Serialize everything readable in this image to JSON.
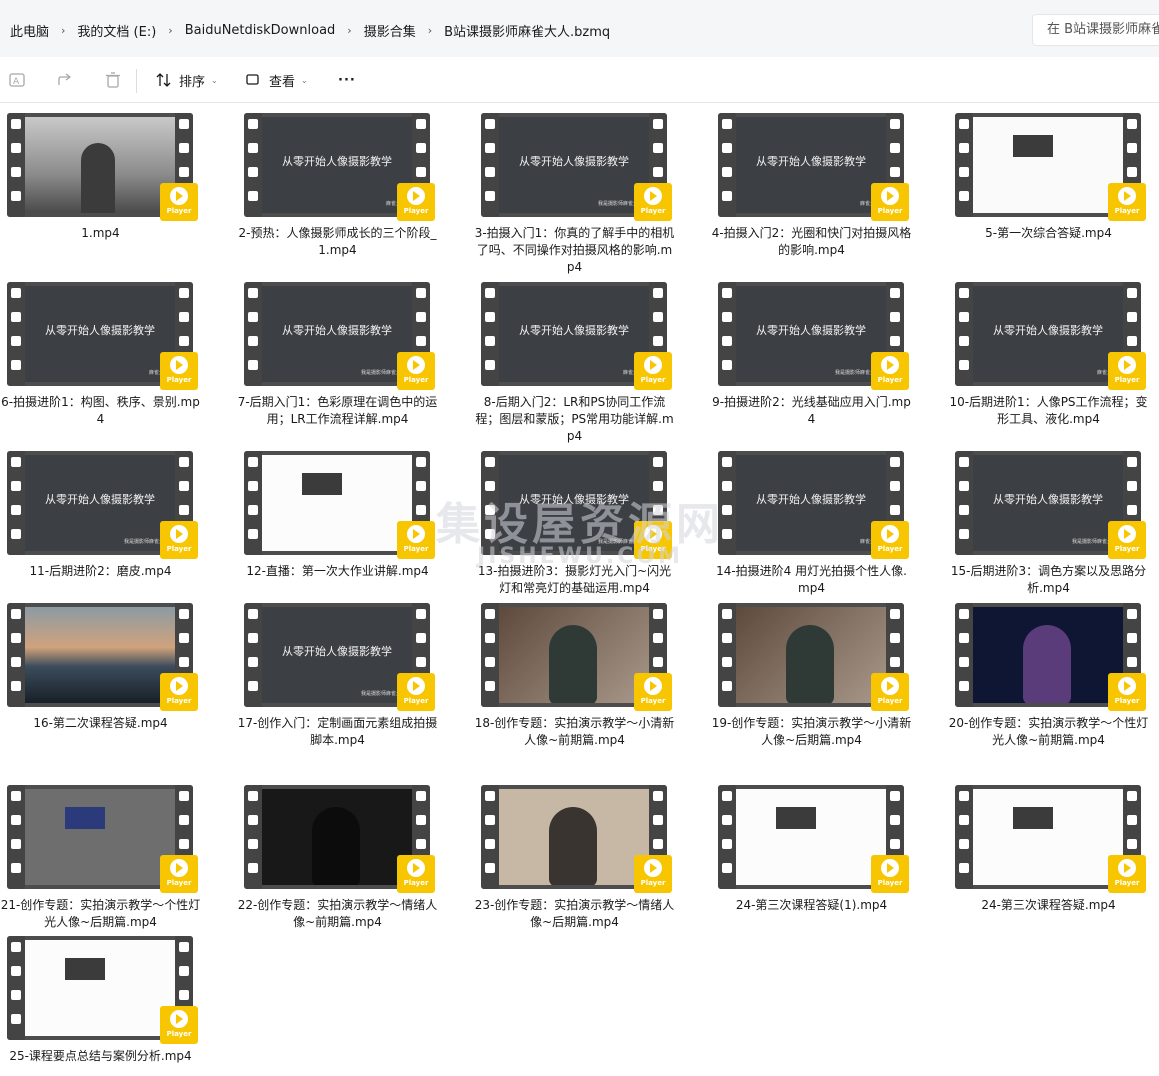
{
  "breadcrumb": [
    "此电脑",
    "我的文档 (E:)",
    "BaiduNetdiskDownload",
    "摄影合集",
    "B站课摄影师麻雀大人.bzmq"
  ],
  "search": {
    "placeholder": "在 B站课摄影师麻雀"
  },
  "toolbar": {
    "sort_label": "排序",
    "view_label": "查看",
    "more_label": "···"
  },
  "badge_label": "Player",
  "thumb_text": {
    "title": "从零开始人像摄影教学",
    "subtitles": [
      "我是摄影师麻雀大人",
      "麻雀大人"
    ]
  },
  "files": [
    {
      "name": "1.mp4",
      "thumb": "mist"
    },
    {
      "name": "2-预热：人像摄影师成长的三个阶段_1.mp4",
      "thumb": "board"
    },
    {
      "name": "3-拍摄入门1：你真的了解手中的相机了吗、不同操作对拍摄风格的影响.mp4",
      "thumb": "board"
    },
    {
      "name": "4-拍摄入门2：光圈和快门对拍摄风格的影响.mp4",
      "thumb": "board"
    },
    {
      "name": "5-第一次综合答疑.mp4",
      "thumb": "white"
    },
    {
      "name": "6-拍摄进阶1：构图、秩序、景别.mp4",
      "thumb": "board"
    },
    {
      "name": "7-后期入门1：色彩原理在调色中的运用；LR工作流程详解.mp4",
      "thumb": "board"
    },
    {
      "name": "8-后期入门2：LR和PS协同工作流程；图层和蒙版；PS常用功能详解.mp4",
      "thumb": "board"
    },
    {
      "name": "9-拍摄进阶2：光线基础应用入门.mp4",
      "thumb": "board"
    },
    {
      "name": "10-后期进阶1：人像PS工作流程；变形工具、液化.mp4",
      "thumb": "board"
    },
    {
      "name": "11-后期进阶2：磨皮.mp4",
      "thumb": "board"
    },
    {
      "name": "12-直播：第一次大作业讲解.mp4",
      "thumb": "app"
    },
    {
      "name": "13-拍摄进阶3：摄影灯光入门~闪光灯和常亮灯的基础运用.mp4",
      "thumb": "board"
    },
    {
      "name": "14-拍摄进阶4 用灯光拍摄个性人像.mp4",
      "thumb": "board"
    },
    {
      "name": "15-后期进阶3：调色方案以及思路分析.mp4",
      "thumb": "board"
    },
    {
      "name": "16-第二次课程答疑.mp4",
      "thumb": "sunset"
    },
    {
      "name": "17-创作入门：定制画面元素组成拍摄脚本.mp4",
      "thumb": "board"
    },
    {
      "name": "18-创作专题：实拍演示教学～小清新人像~前期篇.mp4",
      "thumb": "soft"
    },
    {
      "name": "19-创作专题：实拍演示教学～小清新人像~后期篇.mp4",
      "thumb": "soft"
    },
    {
      "name": "20-创作专题：实拍演示教学～个性灯光人像~前期篇.mp4",
      "thumb": "blue"
    },
    {
      "name": "21-创作专题：实拍演示教学～个性灯光人像~后期篇.mp4",
      "thumb": "editor"
    },
    {
      "name": "22-创作专题：实拍演示教学～情绪人像~前期篇.mp4",
      "thumb": "dark"
    },
    {
      "name": "23-创作专题：实拍演示教学～情绪人像~后期篇.mp4",
      "thumb": "room"
    },
    {
      "name": "24-第三次课程答疑(1).mp4",
      "thumb": "app"
    },
    {
      "name": "24-第三次课程答疑.mp4",
      "thumb": "app"
    },
    {
      "name": "25-课程要点总结与案例分析.mp4",
      "thumb": "app"
    }
  ],
  "watermark": {
    "cn": "集设屋资源网",
    "en": "JISHEWU.COM"
  }
}
